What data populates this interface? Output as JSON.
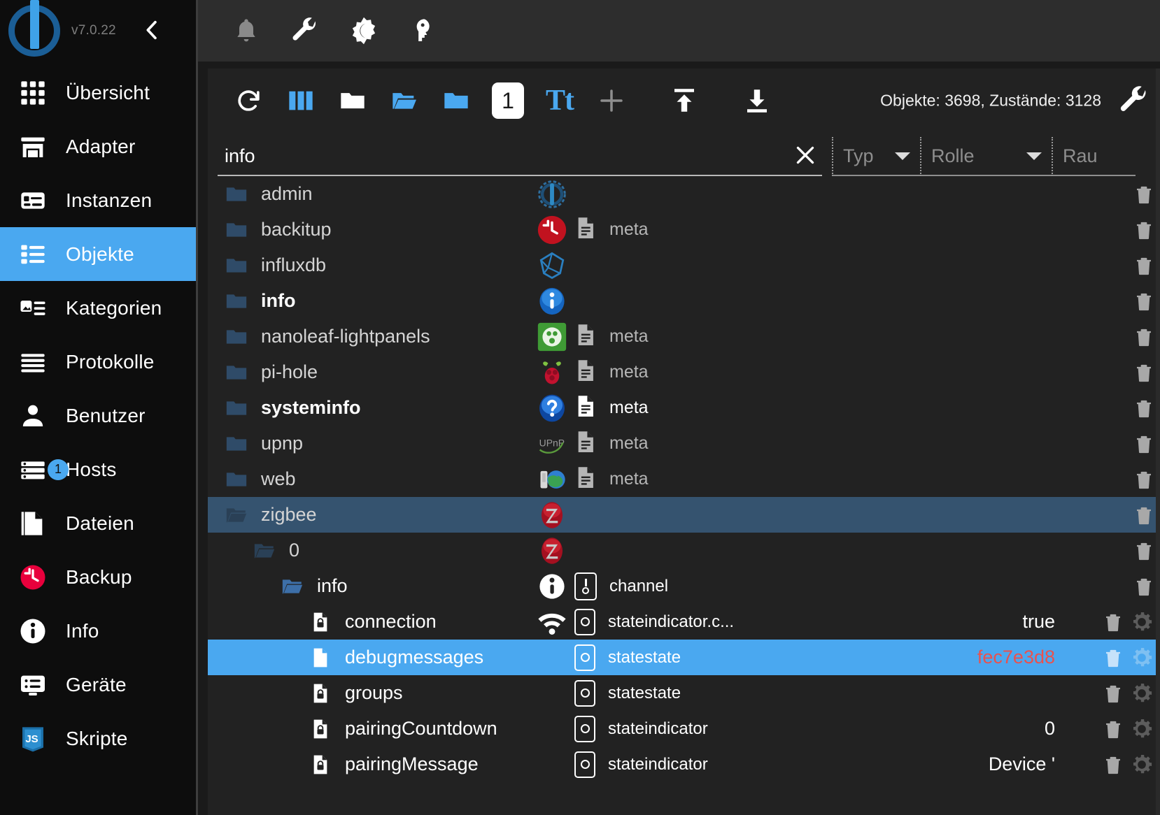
{
  "sidebar": {
    "version": "v7.0.22",
    "collapse_icon": "chevron-left-icon",
    "items": [
      {
        "label": "Übersicht",
        "icon": "grid-icon",
        "active": false
      },
      {
        "label": "Adapter",
        "icon": "store-icon",
        "active": false
      },
      {
        "label": "Instanzen",
        "icon": "instances-icon",
        "active": false
      },
      {
        "label": "Objekte",
        "icon": "list-icon",
        "active": true
      },
      {
        "label": "Kategorien",
        "icon": "categories-icon",
        "active": false
      },
      {
        "label": "Protokolle",
        "icon": "lines-icon",
        "active": false
      },
      {
        "label": "Benutzer",
        "icon": "user-icon",
        "active": false
      },
      {
        "label": "Hosts",
        "icon": "hosts-icon",
        "active": false,
        "badge": "1"
      },
      {
        "label": "Dateien",
        "icon": "file-icon",
        "active": false
      },
      {
        "label": "Backup",
        "icon": "backup-clock-icon",
        "active": false
      },
      {
        "label": "Info",
        "icon": "info-circle-icon",
        "active": false
      },
      {
        "label": "Geräte",
        "icon": "devices-icon",
        "active": false
      },
      {
        "label": "Skripte",
        "icon": "js-icon",
        "active": false
      }
    ]
  },
  "topbar": {
    "icons": [
      {
        "name": "bell-icon"
      },
      {
        "name": "wrench-icon"
      },
      {
        "name": "brightness-moon-icon"
      },
      {
        "name": "expert-head-icon"
      }
    ]
  },
  "toolbar": {
    "buttons": [
      {
        "name": "refresh-icon"
      },
      {
        "name": "columns-icon"
      },
      {
        "name": "collapse-all-folder-icon"
      },
      {
        "name": "expand-all-folder-icon"
      },
      {
        "name": "collapse-folder-icon"
      },
      {
        "name": "depth-one-icon",
        "label": "1"
      },
      {
        "name": "text-size-icon",
        "label": "Tt"
      },
      {
        "name": "add-icon"
      },
      {
        "name": "import-icon"
      },
      {
        "name": "export-icon"
      }
    ],
    "counts": "Objekte: 3698, Zustände: 3128",
    "settings_icon": "wrench-icon"
  },
  "filters": {
    "search_value": "info",
    "search_placeholder": "",
    "clear_icon": "close-x-icon",
    "typ": {
      "label": "Typ"
    },
    "rolle": {
      "label": "Rolle"
    },
    "raum": {
      "label": "Rau"
    }
  },
  "tree": {
    "rows": [
      {
        "name": "admin",
        "indent": 0,
        "icon": "folder-closed-icon",
        "bold": false,
        "adapter": "admin-gear-icon",
        "meta": "",
        "role": "",
        "role_icon": "",
        "value": "",
        "value_red": false,
        "selected": "none",
        "has_gear": false
      },
      {
        "name": "backitup",
        "indent": 0,
        "icon": "folder-closed-icon",
        "bold": false,
        "adapter": "backitup-clock-icon",
        "meta": "meta",
        "role": "",
        "role_icon": "",
        "value": "",
        "value_red": false,
        "selected": "none",
        "has_gear": false
      },
      {
        "name": "influxdb",
        "indent": 0,
        "icon": "folder-closed-icon",
        "bold": false,
        "adapter": "influxdb-icon",
        "meta": "",
        "role": "",
        "role_icon": "",
        "value": "",
        "value_red": false,
        "selected": "none",
        "has_gear": false
      },
      {
        "name": "info",
        "indent": 0,
        "icon": "folder-closed-icon",
        "bold": true,
        "adapter": "info-blue-icon",
        "meta": "",
        "role": "",
        "role_icon": "",
        "value": "",
        "value_red": false,
        "selected": "none",
        "has_gear": false
      },
      {
        "name": "nanoleaf-lightpanels",
        "indent": 0,
        "icon": "folder-closed-icon",
        "bold": false,
        "adapter": "nanoleaf-icon",
        "meta": "meta",
        "role": "",
        "role_icon": "",
        "value": "",
        "value_red": false,
        "selected": "none",
        "has_gear": false
      },
      {
        "name": "pi-hole",
        "indent": 0,
        "icon": "folder-closed-icon",
        "bold": false,
        "adapter": "pihole-raspberry-icon",
        "meta": "meta",
        "role": "",
        "role_icon": "",
        "value": "",
        "value_red": false,
        "selected": "none",
        "has_gear": false
      },
      {
        "name": "systeminfo",
        "indent": 0,
        "icon": "folder-closed-icon",
        "bold": true,
        "adapter": "question-blue-icon",
        "meta": "meta",
        "meta_bright": true,
        "role": "",
        "role_icon": "",
        "value": "",
        "value_red": false,
        "selected": "none",
        "has_gear": false
      },
      {
        "name": "upnp",
        "indent": 0,
        "icon": "folder-closed-icon",
        "bold": false,
        "adapter": "upnp-icon",
        "meta": "meta",
        "role": "",
        "role_icon": "",
        "value": "",
        "value_red": false,
        "selected": "none",
        "has_gear": false
      },
      {
        "name": "web",
        "indent": 0,
        "icon": "folder-closed-icon",
        "bold": false,
        "adapter": "web-globe-icon",
        "meta": "meta",
        "role": "",
        "role_icon": "",
        "value": "",
        "value_red": false,
        "selected": "none",
        "has_gear": false
      },
      {
        "name": "zigbee",
        "indent": 0,
        "icon": "folder-open-icon",
        "bold": false,
        "adapter": "zigbee-z-icon",
        "meta": "",
        "role": "",
        "role_icon": "",
        "value": "",
        "value_red": false,
        "selected": "soft",
        "has_gear": false
      },
      {
        "name": "0",
        "indent": 1,
        "icon": "folder-open-icon",
        "bold": false,
        "adapter": "zigbee-z-icon",
        "meta": "",
        "role": "",
        "role_icon": "",
        "value": "",
        "value_red": false,
        "selected": "none",
        "has_gear": false
      },
      {
        "name": "info",
        "indent": 2,
        "icon": "folder-open-blue-icon",
        "bold": false,
        "white": true,
        "adapter": "info-white-icon",
        "meta": "",
        "role": "channel",
        "role_icon": "channel-icon",
        "value": "",
        "value_red": false,
        "selected": "none",
        "has_gear": false
      },
      {
        "name": "connection",
        "indent": 3,
        "icon": "state-lock-icon",
        "bold": false,
        "white": true,
        "adapter": "wifi-icon",
        "meta": "",
        "role": "stateindicator.c...",
        "role_icon": "state-circle-icon",
        "value": "true",
        "value_red": false,
        "selected": "none",
        "has_gear": true
      },
      {
        "name": "debugmessages",
        "indent": 3,
        "icon": "state-file-icon",
        "bold": false,
        "white": true,
        "adapter": "",
        "meta": "",
        "role": "statestate",
        "role_icon": "state-circle-icon",
        "value": "fec7e3d8",
        "value_red": true,
        "selected": "full",
        "has_gear": true
      },
      {
        "name": "groups",
        "indent": 3,
        "icon": "state-lock-icon",
        "bold": false,
        "white": true,
        "adapter": "",
        "meta": "",
        "role": "statestate",
        "role_icon": "state-circle-icon",
        "value": "",
        "value_red": false,
        "selected": "none",
        "has_gear": true
      },
      {
        "name": "pairingCountdown",
        "indent": 3,
        "icon": "state-lock-icon",
        "bold": false,
        "white": true,
        "adapter": "",
        "meta": "",
        "role": "stateindicator",
        "role_icon": "state-circle-icon",
        "value": "0",
        "value_red": false,
        "selected": "none",
        "has_gear": true
      },
      {
        "name": "pairingMessage",
        "indent": 3,
        "icon": "state-lock-icon",
        "bold": false,
        "white": true,
        "adapter": "",
        "meta": "",
        "role": "stateindicator",
        "role_icon": "state-circle-icon",
        "value": "Device '",
        "value_red": false,
        "selected": "none",
        "has_gear": true
      }
    ]
  },
  "colors": {
    "accent": "#4aa8f0",
    "soft_select": "#35536f",
    "red_value": "#e8524f",
    "panel_bg": "#222222",
    "sidebar_bg": "#0d0d0d"
  }
}
